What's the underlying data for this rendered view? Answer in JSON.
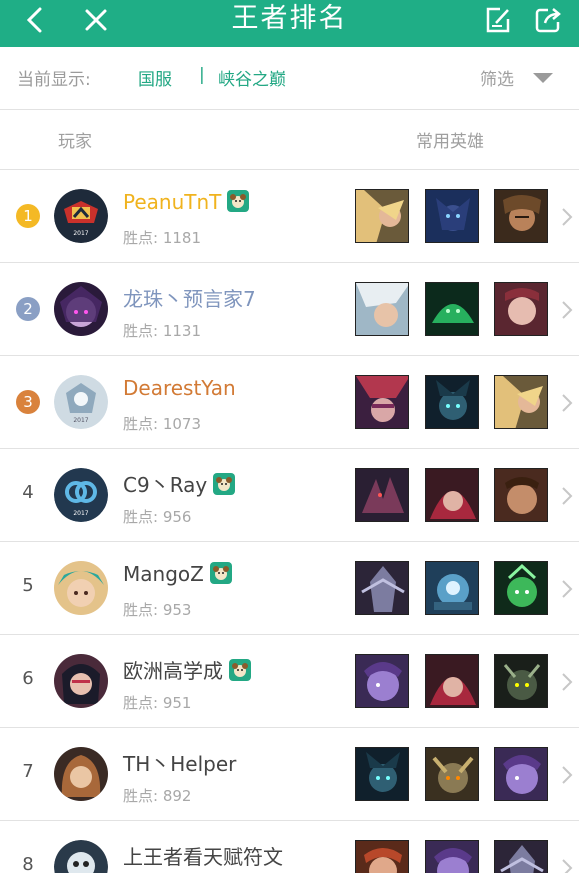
{
  "header": {
    "title": "王者排名"
  },
  "filter": {
    "label": "当前显示:",
    "server": "国服",
    "separator": "|",
    "map": "峡谷之巅",
    "filter_label": "筛选"
  },
  "columns": {
    "player": "玩家",
    "heroes": "常用英雄"
  },
  "colors": {
    "accent": "#1fae86",
    "gold": "#f4b925",
    "silver": "#8a9fc4",
    "bronze": "#d9823c"
  },
  "players": [
    {
      "rank": "1",
      "name": "PeanuTnT",
      "points": "胜点: 1181",
      "badge": true,
      "name_color": "#f0b31e"
    },
    {
      "rank": "2",
      "name": "龙珠丶预言家7",
      "points": "胜点: 1131",
      "badge": false,
      "name_color": "#7f95bd"
    },
    {
      "rank": "3",
      "name": "DearestYan",
      "points": "胜点: 1073",
      "badge": false,
      "name_color": "#d27a35"
    },
    {
      "rank": "4",
      "name": "C9丶Ray",
      "points": "胜点: 956",
      "badge": true,
      "name_color": "#444444"
    },
    {
      "rank": "5",
      "name": "MangoZ",
      "points": "胜点: 953",
      "badge": true,
      "name_color": "#444444"
    },
    {
      "rank": "6",
      "name": "欧洲高学成",
      "points": "胜点: 951",
      "badge": true,
      "name_color": "#444444"
    },
    {
      "rank": "7",
      "name": "TH丶Helper",
      "points": "胜点: 892",
      "badge": false,
      "name_color": "#444444"
    },
    {
      "rank": "8",
      "name": "上王者看天赋符文",
      "points": "",
      "badge": false,
      "name_color": "#444444"
    }
  ]
}
